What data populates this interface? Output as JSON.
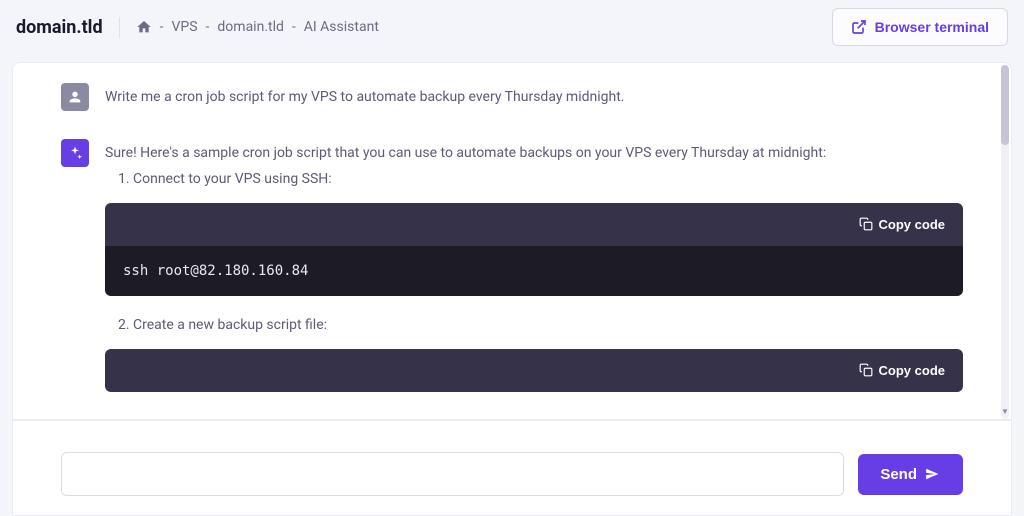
{
  "header": {
    "title": "domain.tld",
    "breadcrumb": {
      "vps": "VPS",
      "domain": "domain.tld",
      "page": "AI Assistant",
      "sep": " - "
    },
    "terminal_button": "Browser terminal"
  },
  "chat": {
    "user_message": "Write me a cron job script for my VPS to automate backup every Thursday midnight.",
    "ai_intro": "Sure! Here's a sample cron job script that you can use to automate backups on your VPS every Thursday at midnight:",
    "step1": "Connect to your VPS using SSH:",
    "step2": "Create a new backup script file:",
    "copy_label": "Copy code",
    "code1": "ssh root@82.180.160.84"
  },
  "input": {
    "placeholder": "",
    "send_label": "Send"
  }
}
